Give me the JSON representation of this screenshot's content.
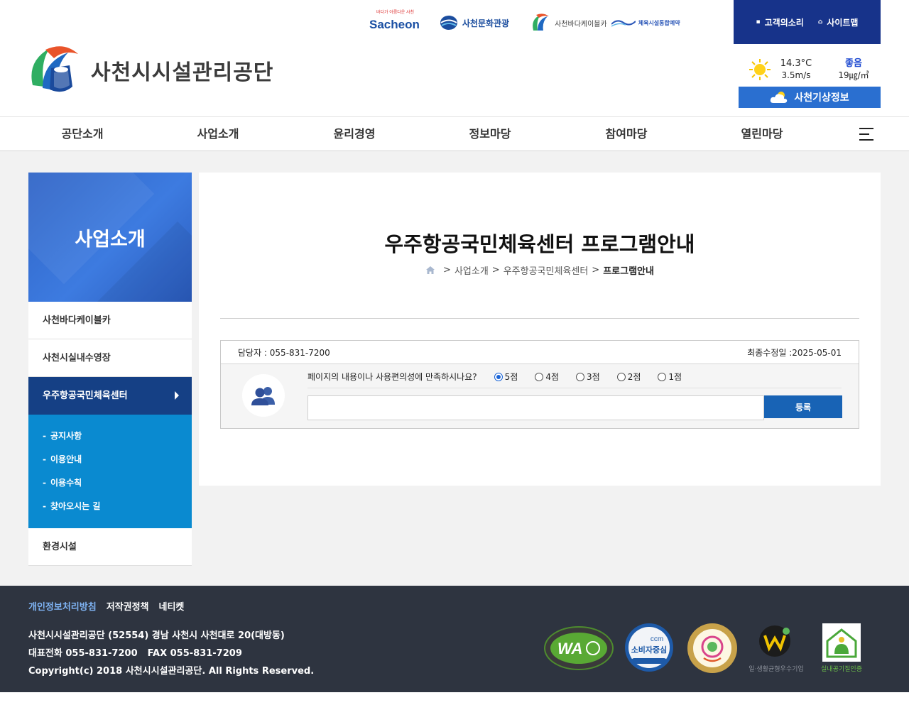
{
  "header": {
    "partners": {
      "sacheon_brand": "Sacheon",
      "sacheon_tagline": "바다가 아름다운 사천",
      "culture": "사천문화관광",
      "cablecar": "사천바다케이블카",
      "sports": "체육시설통합예약"
    },
    "top_links": {
      "voice": "고객의소리",
      "sitemap": "사이트맵"
    },
    "logo_text": "사천시시설관리공단",
    "weather": {
      "temperature": "14.3°C",
      "wind": "3.5m/s",
      "air_grade": "좋음",
      "air_value": "19㎍/㎥",
      "button": "사천기상정보"
    }
  },
  "gnb": {
    "items": [
      "공단소개",
      "사업소개",
      "윤리경영",
      "정보마당",
      "참여마당",
      "열린마당"
    ]
  },
  "lnb": {
    "title": "사업소개",
    "items": [
      "사천바다케이블카",
      "사천시실내수영장",
      "우주항공국민체육센터",
      "환경시설"
    ],
    "sub_items": [
      "공지사항",
      "이용안내",
      "이용수칙",
      "찾아오시는 길"
    ],
    "sub_dash": "-"
  },
  "main": {
    "page_title": "우주항공국민체육센터 프로그램안내",
    "breadcrumb": {
      "sep": ">",
      "level1": "사업소개",
      "level2": "우주항공국민체육센터",
      "current": "프로그램안내"
    }
  },
  "survey": {
    "manager": "담당자 : 055-831-7200",
    "modified": "최종수정일 :2025-05-01",
    "question": "페이지의 내용이나 사용편의성에 만족하시나요?",
    "options": [
      "5점",
      "4점",
      "3점",
      "2점",
      "1점"
    ],
    "selected": "5점",
    "submit": "등록"
  },
  "footer": {
    "links": [
      "개인정보처리방침",
      "저작권정책",
      "네티켓"
    ],
    "address": "사천시시설관리공단 (52554) 경남 사천시 사천대로 20(대방동)",
    "tel": "대표전화 055-831-7200",
    "fax": "FAX 055-831-7209",
    "copyright": "Copyright(c) 2018 사천시시설관리공단. All Rights Reserved.",
    "certs": {
      "wa": "WA",
      "ccm_brand": "ccm",
      "ccm_label": "소비자중심",
      "wlb_label": "일·생활균형우수기업",
      "air_label": "실내공기질인증"
    }
  },
  "colors": {
    "brand_navy": "#17338a",
    "lnb_active": "#154085",
    "lnb_sub": "#0a8ad0",
    "submit": "#1863b5",
    "footer_bg": "#2e3440"
  }
}
